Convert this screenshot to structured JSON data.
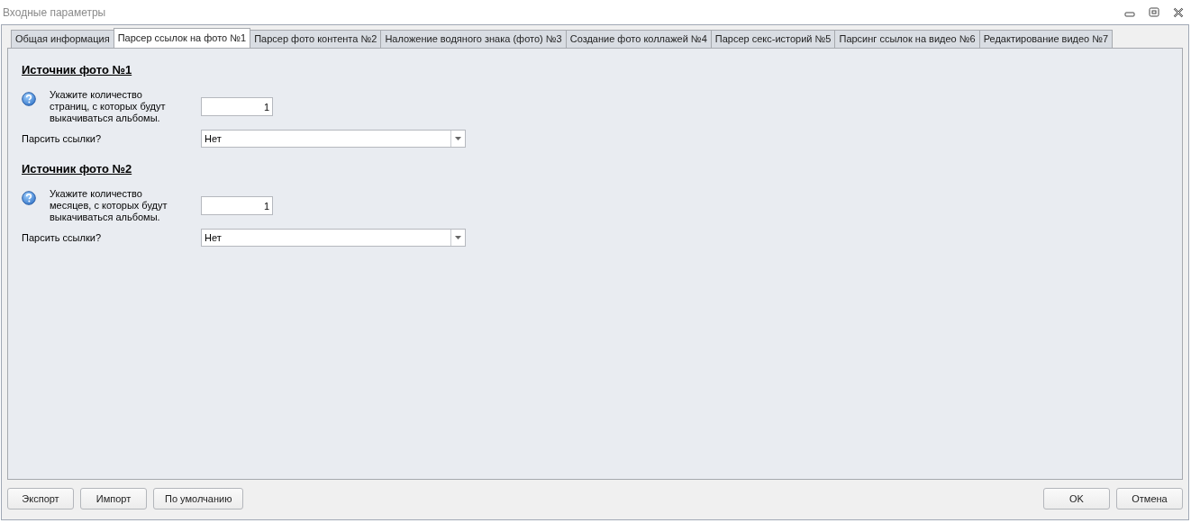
{
  "window": {
    "title": "Входные параметры"
  },
  "tabs": [
    {
      "label": "Общая информация",
      "selected": false
    },
    {
      "label": "Парсер ссылок на фото №1",
      "selected": true
    },
    {
      "label": "Парсер фото контента №2",
      "selected": false
    },
    {
      "label": "Наложение водяного знака (фото) №3",
      "selected": false
    },
    {
      "label": "Создание фото коллажей №4",
      "selected": false
    },
    {
      "label": "Парсер секс-историй №5",
      "selected": false
    },
    {
      "label": "Парсинг ссылок на видео №6",
      "selected": false
    },
    {
      "label": "Редактирование видео №7",
      "selected": false
    }
  ],
  "sections": [
    {
      "heading": "Источник фото №1",
      "fields": [
        {
          "kind": "number",
          "label": "Укажите количество страниц, с которых будут выкачиваться альбомы.",
          "help": true,
          "value": "1"
        },
        {
          "kind": "dropdown",
          "label": "Парсить ссылки?",
          "value": "Нет"
        }
      ]
    },
    {
      "heading": "Источник фото №2",
      "fields": [
        {
          "kind": "number",
          "label": "Укажите количество месяцев, с которых будут выкачиваться альбомы.",
          "help": true,
          "value": "1"
        },
        {
          "kind": "dropdown",
          "label": "Парсить ссылки?",
          "value": "Нет"
        }
      ]
    }
  ],
  "left_buttons": [
    "Экспорт",
    "Импорт",
    "По умолчанию"
  ],
  "right_buttons": [
    "OK",
    "Отмена"
  ]
}
